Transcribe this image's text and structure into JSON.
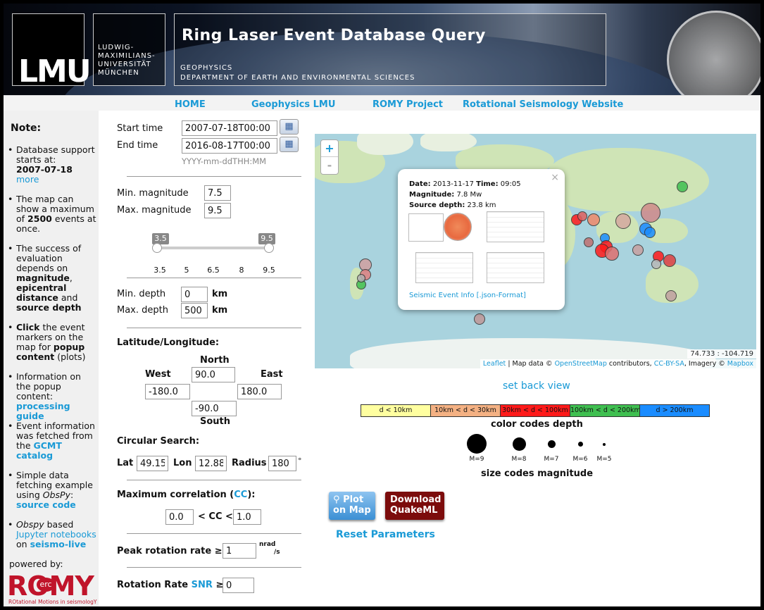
{
  "header": {
    "logo": "LMU",
    "university": "LUDWIG-\nMAXIMILIANS-\nUNIVERSITÄT\nMÜNCHEN",
    "title": "Ring Laser Event Database Query",
    "dept_line1": "GEOPHYSICS",
    "dept_line2": "DEPARTMENT OF EARTH AND ENVIRONMENTAL SCIENCES"
  },
  "nav": {
    "home": "HOME",
    "geo": "Geophysics LMU",
    "romy": "ROMY Project",
    "rot": "Rotational Seismology Website"
  },
  "sidebar": {
    "title": "Note:",
    "n1_a": "Database support starts at:",
    "n1_date": "2007-07-18",
    "n1_more": "more",
    "n2_a": "The map can show a maximum of",
    "n2_num": "2500",
    "n2_b": "events at once.",
    "n3_a": "The success of evaluation depends on",
    "n3_b": "magnitude",
    "n3_c": "epicentral distance",
    "n3_d": "and",
    "n3_e": "source depth",
    "n4_a": "Click",
    "n4_b": "the event markers on the map for",
    "n4_c": "popup content",
    "n4_d": "(plots)",
    "n5_a": "Information on the popup content:",
    "n5_link": "processing guide",
    "n6_a": "Event information was fetched from the",
    "n6_link": "GCMT catalog",
    "n7_a": "Simple data fetching example using",
    "n7_b": "ObsPy",
    "n7_link": "source code",
    "n8_a": "Obspy",
    "n8_b": "based",
    "n8_link1": "Jupyter notebooks",
    "n8_c": "on",
    "n8_link2": "seismo-live",
    "powered": "powered by:",
    "romy_logo": "ROMY",
    "romy_erc": "erc",
    "romy_sub": "ROtational Motions in seismologY"
  },
  "form": {
    "start_label": "Start time",
    "start_value": "2007-07-18T00:00",
    "end_label": "End time",
    "end_value": "2016-08-17T00:00",
    "date_hint": "YYYY-mm-ddTHH:MM",
    "min_mag_label": "Min. magnitude",
    "min_mag": "7.5",
    "max_mag_label": "Max. magnitude",
    "max_mag": "9.5",
    "slider_low": "3.5",
    "slider_high": "9.5",
    "ticks": [
      "3.5",
      "5",
      "6.5",
      "8",
      "9.5"
    ],
    "min_depth_label": "Min. depth",
    "min_depth": "0",
    "max_depth_label": "Max. depth",
    "max_depth": "500",
    "km": "km",
    "latlon_label": "Latitude/Longitude:",
    "north": "North",
    "south": "South",
    "west": "West",
    "east": "East",
    "north_val": "90.0",
    "south_val": "-90.0",
    "west_val": "-180.0",
    "east_val": "180.0",
    "circ_label": "Circular Search:",
    "lat_label": "Lat",
    "lat_val": "49.15",
    "lon_label": "Lon",
    "lon_val": "12.88",
    "radius_label": "Radius",
    "radius_val": "180",
    "deg": "°",
    "corr_label_a": "Maximum correlation (",
    "corr_link": "CC",
    "corr_label_b": "):",
    "cc_min": "0.0",
    "cc_mid": "< CC <",
    "cc_max": "1.0",
    "peak_label": "Peak rotation rate ≥",
    "peak_val": "1",
    "peak_unit_a": "nrad",
    "peak_unit_b": "/s",
    "snr_label_a": "Rotation Rate",
    "snr_link": "SNR",
    "snr_label_b": "≥",
    "snr_val": "0"
  },
  "map": {
    "zoom_in": "+",
    "zoom_out": "-",
    "popup": {
      "date_label": "Date:",
      "date": "2013-11-17",
      "time_label": "Time:",
      "time": "09:05",
      "mag_label": "Magnitude:",
      "mag": "7.8 Mw",
      "depth_label": "Source depth:",
      "depth": "23.8 km",
      "link": "Seismic Event Info [.json-Format]",
      "close": "×"
    },
    "coords": "74.733 : -104.719",
    "attr_leaflet": "Leaflet",
    "attr_a": "| Map data ©",
    "attr_osm": "OpenStreetMap",
    "attr_b": "contributors,",
    "attr_cc": "CC-BY-SA",
    "attr_c": ", Imagery ©",
    "attr_mb": "Mapbox"
  },
  "set_back_view": "set back view",
  "legend": {
    "depth_bins": [
      "d < 10km",
      "10km < d < 30km",
      "30km < d < 100km",
      "100km < d < 200km",
      "d > 200km"
    ],
    "depth_colors": [
      "#ffffa0",
      "#f4b183",
      "#ff1a1a",
      "#3fbf50",
      "#1a8cff"
    ],
    "depth_caption": "color codes depth",
    "mag_labels": [
      "M=9",
      "M=8",
      "M=7",
      "M=6",
      "M=5"
    ],
    "mag_caption": "size codes magnitude"
  },
  "buttons": {
    "plot_a": "Plot",
    "plot_b": "on Map",
    "dl_a": "Download",
    "dl_b": "QuakeML",
    "reset": "Reset Parameters"
  }
}
